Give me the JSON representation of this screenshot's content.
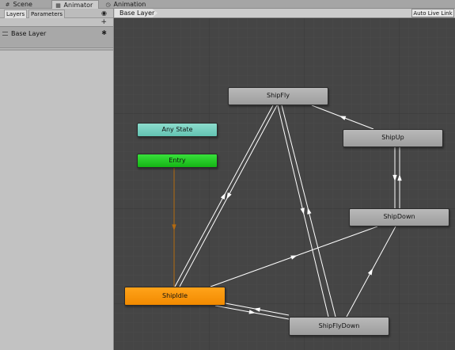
{
  "window_tabs": [
    {
      "label": "Scene",
      "icon": "grid-icon"
    },
    {
      "label": "Animator",
      "icon": "animator-icon"
    },
    {
      "label": "Animation",
      "icon": "clock-icon"
    }
  ],
  "left_panel": {
    "tabs": [
      "Layers",
      "Parameters"
    ],
    "layers": [
      {
        "name": "Base Layer"
      }
    ]
  },
  "toolbar": {
    "breadcrumb": "Base Layer",
    "live_link_label": "Auto Live Link"
  },
  "graph": {
    "states": {
      "any_state": "Any State",
      "entry": "Entry",
      "ship_fly": "ShipFly",
      "ship_up": "ShipUp",
      "ship_down": "ShipDown",
      "ship_idle": "ShipIdle",
      "ship_fly_down": "ShipFlyDown"
    },
    "colors": {
      "background": "#454545",
      "grid_minor": "#4b4b4b",
      "grid_major": "#363636",
      "state_default": "#a8a8a8",
      "any_state": "#79d1c1",
      "entry": "#25c927",
      "default_state": "#f79400",
      "entry_transition": "#b46a0f",
      "transition": "#ffffff"
    }
  }
}
